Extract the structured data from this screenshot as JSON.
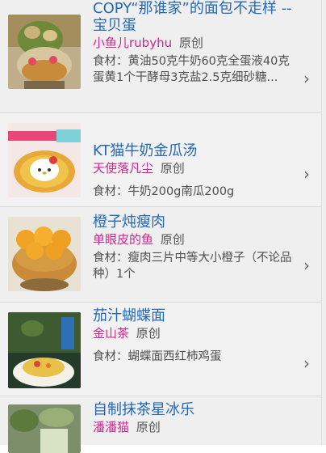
{
  "recipes": [
    {
      "title": "COPY“那谁家”的面包不走样 -- 宝贝蛋",
      "author": "小鱼儿rubyhu",
      "badge": "原创",
      "ingredients": "食材：黄油50克牛奶60克全蛋液40克蛋黄1个干酵母3克盐2.5克细砂糖..."
    },
    {
      "title": "KT猫牛奶金瓜汤",
      "author": "天使落凡尘",
      "badge": "原创",
      "ingredients": "食材：牛奶200g南瓜200g"
    },
    {
      "title": "橙子炖瘦肉",
      "author": "单眼皮的鱼",
      "badge": "原创",
      "ingredients": "食材：瘦肉三片中等大小橙子（不论品种）1个"
    },
    {
      "title": "茄汁蝴蝶面",
      "author": "金山茶",
      "badge": "原创",
      "ingredients": "食材：蝴蝶面西红柿鸡蛋"
    },
    {
      "title": "自制抹茶星冰乐",
      "author": "潘潘猫",
      "badge": "原创",
      "ingredients": ""
    }
  ],
  "chevron": "›",
  "colors": {
    "title": "#2469b8",
    "author": "#d6238f",
    "row_bg": "#efefef"
  },
  "icons": [
    "chevron-right-icon"
  ]
}
